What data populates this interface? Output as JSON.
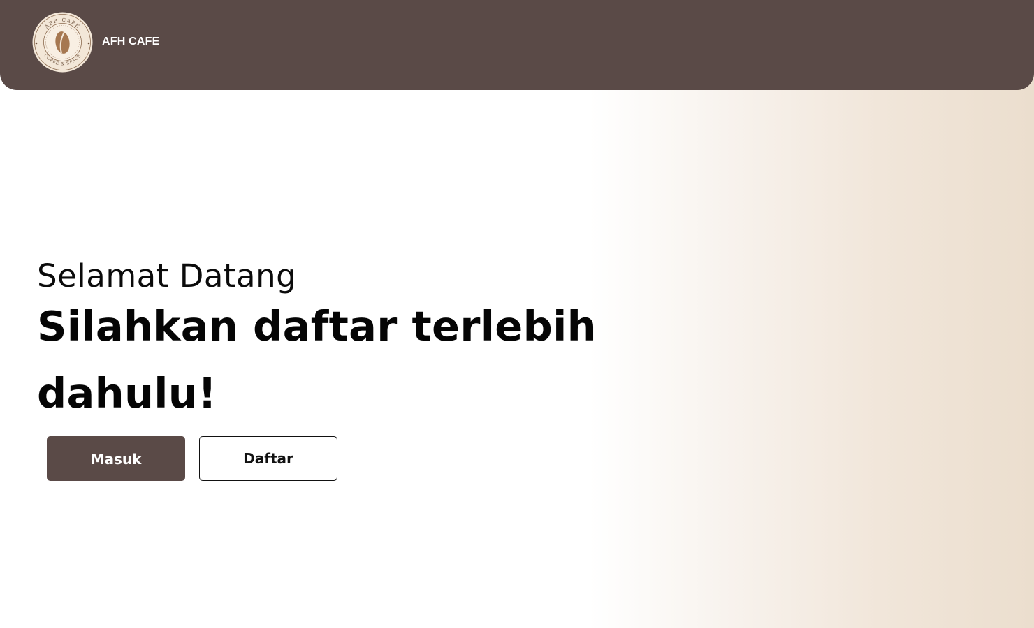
{
  "header": {
    "brand_name": "AFH CAFE",
    "logo": {
      "icon": "coffee-bean-logo",
      "top_text": "AFH CAFE",
      "bottom_text": "COFFE & SPACE"
    }
  },
  "hero": {
    "greeting": "Selamat Datang",
    "headline": "Silahkan daftar terlebih dahulu!"
  },
  "actions": {
    "login_label": "Masuk",
    "register_label": "Daftar"
  },
  "colors": {
    "primary": "#5a4a47",
    "background_gradient_end": "#ebdece",
    "text": "#000000",
    "button_text_light": "#ffffff"
  }
}
